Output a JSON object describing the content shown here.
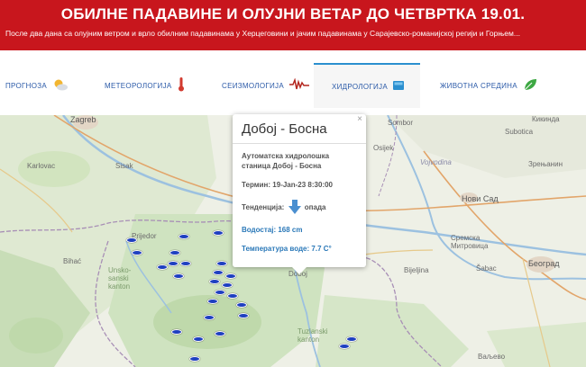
{
  "alert": {
    "title": "ОБИЛНЕ ПАДАВИНЕ И ОЛУЈНИ ВЕТАР ДО ЧЕТВРТКА 19.01.",
    "text": "После два дана са олујним ветром и врло обилним падавинама у Херцеговини и јачим падавинама у Сарајевско-романијској регији и Горњем..."
  },
  "tabs": [
    {
      "label": "ПРОГНОЗА",
      "icon": "sun-cloud-icon"
    },
    {
      "label": "МЕТЕОРОЛОГИЈА",
      "icon": "thermometer-icon"
    },
    {
      "label": "СЕИЗМОЛОГИЈА",
      "icon": "seismograph-icon"
    },
    {
      "label": "ХИДРОЛОГИЈА",
      "icon": "water-gauge-icon"
    },
    {
      "label": "ЖИВОТНА СРЕДИНА",
      "icon": "leaf-icon"
    }
  ],
  "active_tab": "ХИДРОЛОГИЈА",
  "popup": {
    "title": "Добој - Босна",
    "description": "Аутоматска хидролошка станица Добој - Босна",
    "term_label": "Термин:",
    "term_value": "19-Jan-23 8:30:00",
    "trend_label": "Тенденција:",
    "trend_value": "опада",
    "level_label": "Водостај:",
    "level_value": "168 cm",
    "temp_label": "Температура воде:",
    "temp_value": "7.7 C°",
    "close": "×"
  },
  "map": {
    "labels": {
      "zagreb": "Zagreb",
      "karlovac": "Karlovac",
      "sisak": "Sisak",
      "prijedor": "Prijedor",
      "bihac": "Bihać",
      "unsko_sanski": "Unsko-\nsanski\nkanton",
      "doboj": "Doboj",
      "tuzlanski": "Tuzlanski\nkanton",
      "bijeljina": "Bijeljina",
      "sabac": "Šabac",
      "beograd": "Београд",
      "novi_sad": "Нови Сад",
      "vojvodina": "Vojvodina",
      "sremska": "Сремска\nМитровица",
      "valjevo": "Ваљево",
      "kikinda": "Кикинда",
      "zrenjanin": "Зрењанин",
      "sombor": "Sombor",
      "subotica": "Subotica",
      "osijek": "Osijek"
    }
  }
}
